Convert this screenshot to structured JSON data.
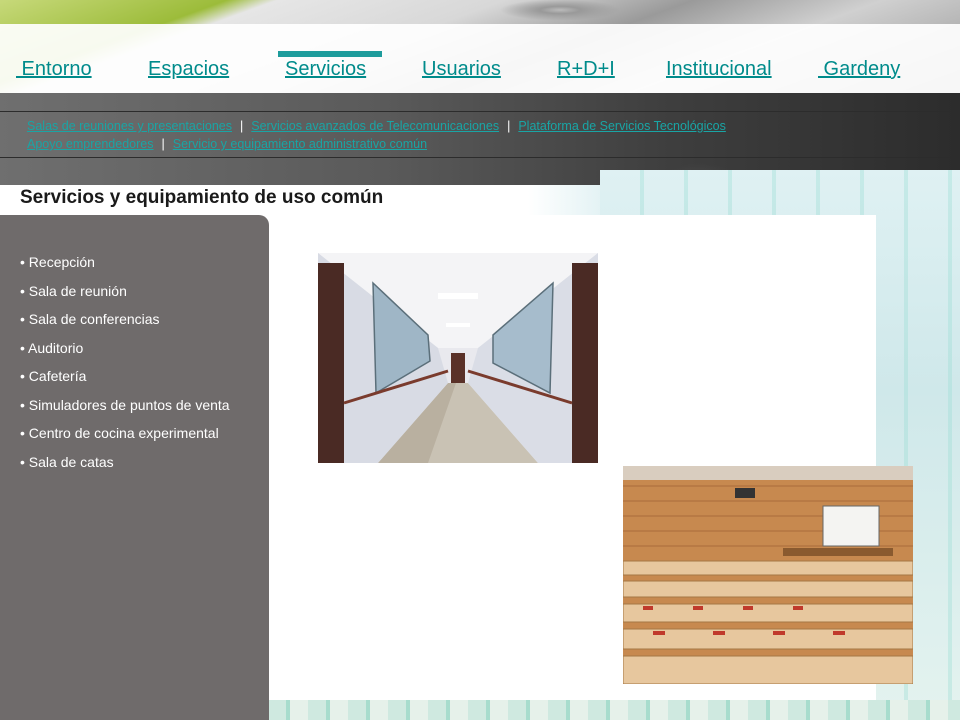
{
  "nav": {
    "items": [
      {
        "label": " Entorno",
        "name": "nav-entorno"
      },
      {
        "label": "Espacios",
        "name": "nav-espacios"
      },
      {
        "label": "Servicios",
        "name": "nav-servicios"
      },
      {
        "label": "Usuarios",
        "name": "nav-usuarios"
      },
      {
        "label": "R+D+I",
        "name": "nav-rdi"
      },
      {
        "label": "Institucional",
        "name": "nav-institucional"
      },
      {
        "label": " Gardeny",
        "name": "nav-gardeny"
      }
    ],
    "active": "Servicios"
  },
  "subnav": {
    "line1": [
      "Salas de reuniones y presentaciones",
      "Servicios avanzados de Telecomunicaciones",
      "Plataforma de Servicios Tecnológicos"
    ],
    "line2": [
      "Apoyo emprendedores",
      "Servicio y equipamiento administrativo común"
    ],
    "separator": "|"
  },
  "page": {
    "title": "Servicios y equipamiento de uso común"
  },
  "sidebar": {
    "items": [
      "• Recepción",
      "• Sala de reunión",
      "• Sala de conferencias",
      "• Auditorio",
      "• Cafetería",
      "• Simuladores de puntos de venta",
      "• Centro de cocina experimental",
      "• Sala de catas"
    ]
  },
  "colors": {
    "link": "#008b8b",
    "sublink": "#19a5a5",
    "sidebar_bg": "#6f6b6b",
    "active_indicator": "#1e9c9c"
  },
  "images": {
    "corridor": "corridor-photo",
    "auditorium": "auditorium-photo"
  }
}
